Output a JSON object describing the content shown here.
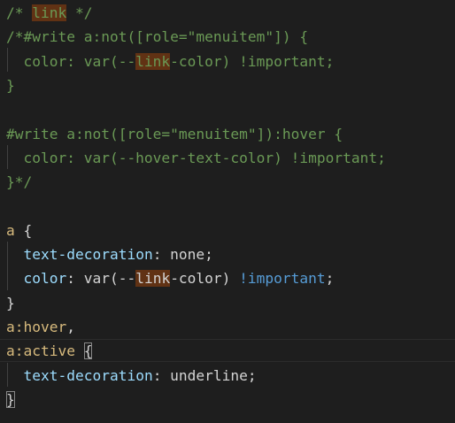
{
  "lines": [
    {
      "tokens": [
        {
          "t": "/* ",
          "k": "c"
        },
        {
          "t": "link",
          "k": "c",
          "hl": true
        },
        {
          "t": " */",
          "k": "c"
        }
      ]
    },
    {
      "tokens": [
        {
          "t": "/*#write a:not([role=\"menuitem\"]) {",
          "k": "c"
        }
      ]
    },
    {
      "tokens": [
        {
          "t": "  color: var(--",
          "k": "c"
        },
        {
          "t": "link",
          "k": "c",
          "hl": true
        },
        {
          "t": "-color) !important;",
          "k": "c"
        }
      ]
    },
    {
      "tokens": [
        {
          "t": "}",
          "k": "c"
        }
      ]
    },
    {
      "tokens": []
    },
    {
      "tokens": [
        {
          "t": "#write a:not([role=\"menuitem\"]):hover {",
          "k": "c"
        }
      ]
    },
    {
      "tokens": [
        {
          "t": "  color: var(--hover-text-color) !important;",
          "k": "c"
        }
      ]
    },
    {
      "tokens": [
        {
          "t": "}*/",
          "k": "c"
        }
      ]
    },
    {
      "tokens": []
    },
    {
      "tokens": [
        {
          "t": "a",
          "k": "sel"
        },
        {
          "t": " {",
          "k": "punc"
        }
      ]
    },
    {
      "tokens": [
        {
          "t": "  ",
          "k": "punc"
        },
        {
          "t": "text-decoration",
          "k": "prop"
        },
        {
          "t": ": none;",
          "k": "val"
        }
      ]
    },
    {
      "tokens": [
        {
          "t": "  ",
          "k": "punc"
        },
        {
          "t": "color",
          "k": "prop"
        },
        {
          "t": ": var(--",
          "k": "val"
        },
        {
          "t": "link",
          "k": "val",
          "hl": true
        },
        {
          "t": "-color) ",
          "k": "val"
        },
        {
          "t": "!important",
          "k": "kw"
        },
        {
          "t": ";",
          "k": "val"
        }
      ]
    },
    {
      "tokens": [
        {
          "t": "}",
          "k": "punc"
        }
      ]
    },
    {
      "tokens": [
        {
          "t": "a:hover",
          "k": "sel"
        },
        {
          "t": ",",
          "k": "punc"
        }
      ]
    },
    {
      "tokens": [
        {
          "t": "a:active",
          "k": "sel"
        },
        {
          "t": " ",
          "k": "punc"
        },
        {
          "t": "{",
          "k": "punc",
          "bm": true
        }
      ]
    },
    {
      "tokens": [
        {
          "t": "  ",
          "k": "punc"
        },
        {
          "t": "text-decoration",
          "k": "prop"
        },
        {
          "t": ": underline;",
          "k": "val"
        }
      ]
    },
    {
      "tokens": [
        {
          "t": "}",
          "k": "punc",
          "bm": true
        }
      ]
    }
  ]
}
